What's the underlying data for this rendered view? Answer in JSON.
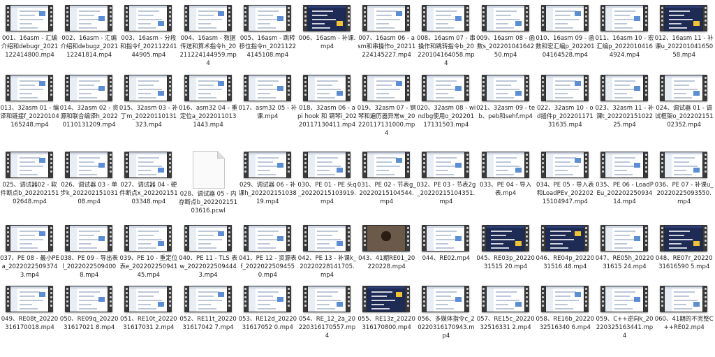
{
  "files": [
    {
      "name": "001、16asm - 汇编介绍和debugr_2021122414800.mp4",
      "thumb": "ui"
    },
    {
      "name": "002、16asm - 汇编介绍和debugz_202112241814.mp4",
      "thumb": "ui"
    },
    {
      "name": "003、16asm - 分段和指令f_20211224144905.mp4",
      "thumb": "ui"
    },
    {
      "name": "004、16asm - 数据传送和算术指令h_20211224144959.mp4",
      "thumb": "ui"
    },
    {
      "name": "005、16asm - 跳转移位指令n_20211224145108.mp4",
      "thumb": "ui"
    },
    {
      "name": "006、16asm - 补课.mp4",
      "thumb": "dark"
    },
    {
      "name": "007、16asm 06 - asm和串操作o_20211224145227.mp4",
      "thumb": "ui"
    },
    {
      "name": "008、16asm 07 - 串操作和跳转指令b_20220104164058.mp4",
      "thumb": "ui"
    },
    {
      "name": "009、16asm 08 - 函数s_20220104164250.mp4",
      "thumb": "ui"
    },
    {
      "name": "010、16asm 09 - 函数和宏汇编p_20220104164528.mp4",
      "thumb": "ui"
    },
    {
      "name": "011、16asm 10 - 宏汇编p_20220104164924.mp4",
      "thumb": "ui"
    },
    {
      "name": "012、16asm 11 - 补课u_20220104165058.mp4",
      "thumb": "dark"
    },
    {
      "name": "013、32asm 01 - 编译和链接f_20220104165248.mp4",
      "thumb": "ui"
    },
    {
      "name": "014、32asm 02 - 资源和联合编译h_20220110131209.mp4",
      "thumb": "ui"
    },
    {
      "name": "015、32asm 03 - 补丁m_20220110131323.mp4",
      "thumb": "ui"
    },
    {
      "name": "016、asm32 04 - 重定位a_20220110131443.mp4",
      "thumb": "ui"
    },
    {
      "name": "017、asm32 05 - 补课.mp4",
      "thumb": "ui"
    },
    {
      "name": "018、32asm 06 - api hook 和 钢琴i_20220117130411.mp4",
      "thumb": "ui"
    },
    {
      "name": "019、32asm 07 - 钢琴和遍历器异常w_20220117131000.mp4",
      "thumb": "ui"
    },
    {
      "name": "020、32asm 08 - windbg使用o_20220117131503.mp4",
      "thumb": "ui"
    },
    {
      "name": "021、32asm 09 - teb、peb和sehf.mp4",
      "thumb": "ui"
    },
    {
      "name": "022、32asm 10 - od插件p_20220117131635.mp4",
      "thumb": "ui"
    },
    {
      "name": "023、32asm 11 - 补课t_20220215102225.mp4",
      "thumb": "ui"
    },
    {
      "name": "024、调试器 01 - 调试框架o_20220215102352.mp4",
      "thumb": "ui"
    },
    {
      "name": "025、调试器02 - 软件断点b_20220215102648.mp4",
      "thumb": "ui"
    },
    {
      "name": "026、调试器 03 - 单步k_20220215103108.mp4",
      "thumb": "ui"
    },
    {
      "name": "027、调试器 04 - 硬件断点x_20220215103348.mp4",
      "thumb": "ui"
    },
    {
      "name": "028、调试器 05 - 内存断点b_20220215103616.pcwl",
      "thumb": "file"
    },
    {
      "name": "029、调试器 06 - 补课h_20220215103819.mp4",
      "thumb": "ui"
    },
    {
      "name": "030、PE 01 - PE 头q_20220215103919.mp4",
      "thumb": "ui"
    },
    {
      "name": "031、PE 02 - 节表g_20220215104544.mp4",
      "thumb": "ui"
    },
    {
      "name": "032、PE 03 - 节表2g_20220215104351.mp4",
      "thumb": "ui"
    },
    {
      "name": "033、PE 04 - 导入表.mp4",
      "thumb": "ui"
    },
    {
      "name": "034、PE 05 - 导入表和LoadPEv_20220215104947.mp4",
      "thumb": "ui"
    },
    {
      "name": "035、PE 06 - LoadPEu_20220225093414.mp4",
      "thumb": "ui"
    },
    {
      "name": "036、PE 07 - 补课u_20220225093550.mp4",
      "thumb": "ui"
    },
    {
      "name": "037、PE 08 - 最小PEa_20220225093743.mp4",
      "thumb": "ui"
    },
    {
      "name": "038、PE 09 - 导出表l_20220225094008.mp4",
      "thumb": "ui"
    },
    {
      "name": "039、PE 10 - 重定位表e_20220225094145.mp4",
      "thumb": "ui"
    },
    {
      "name": "040、PE 11 - TLS 表w_20220225094443.mp4",
      "thumb": "ui"
    },
    {
      "name": "041、PE 12 - 资源表f_20220225094550.mp4",
      "thumb": "ui"
    },
    {
      "name": "042、PE 13 - 补课k_20220228141705.mp4",
      "thumb": "ui"
    },
    {
      "name": "043、41期RE01_20220228.mp4",
      "thumb": "person"
    },
    {
      "name": "044、RE02.mp4",
      "thumb": "ui"
    },
    {
      "name": "045、RE03p_2022031515 20.mp4",
      "thumb": "dark"
    },
    {
      "name": "046、RE04p_2022031516 48.mp4",
      "thumb": "dark"
    },
    {
      "name": "047、RE05h_2022031615 24.mp4",
      "thumb": "ui"
    },
    {
      "name": "048、RE07r_2022031616590 5.mp4",
      "thumb": "dark"
    },
    {
      "name": "049、RE08t_20220316170018.mp4",
      "thumb": "ui"
    },
    {
      "name": "050、RE09q_2022031617021 8.mp4",
      "thumb": "ui"
    },
    {
      "name": "051、RE10t_2022031617031 2.mp4",
      "thumb": "ui"
    },
    {
      "name": "052、RE11t_2022031617042 7.mp4",
      "thumb": "ui"
    },
    {
      "name": "053、RE12d_2022031617052 0.mp4",
      "thumb": "ui"
    },
    {
      "name": "054、RE_12_2a_20220316170557.mp4",
      "thumb": "ui"
    },
    {
      "name": "055、RE13z_20220316170800.mp4",
      "thumb": "dark"
    },
    {
      "name": "056、多媒体指令c_20220316170943.mp4",
      "thumb": "ui"
    },
    {
      "name": "057、RE15c_2022032516331 2.mp4",
      "thumb": "ui"
    },
    {
      "name": "058、RE16b_2022032516340 6.mp4",
      "thumb": "ui"
    },
    {
      "name": "059、C++逆向k_20220325163441.mp4",
      "thumb": "ui"
    },
    {
      "name": "060、41期的不完整C++RE02.mp4",
      "thumb": "ui"
    }
  ]
}
